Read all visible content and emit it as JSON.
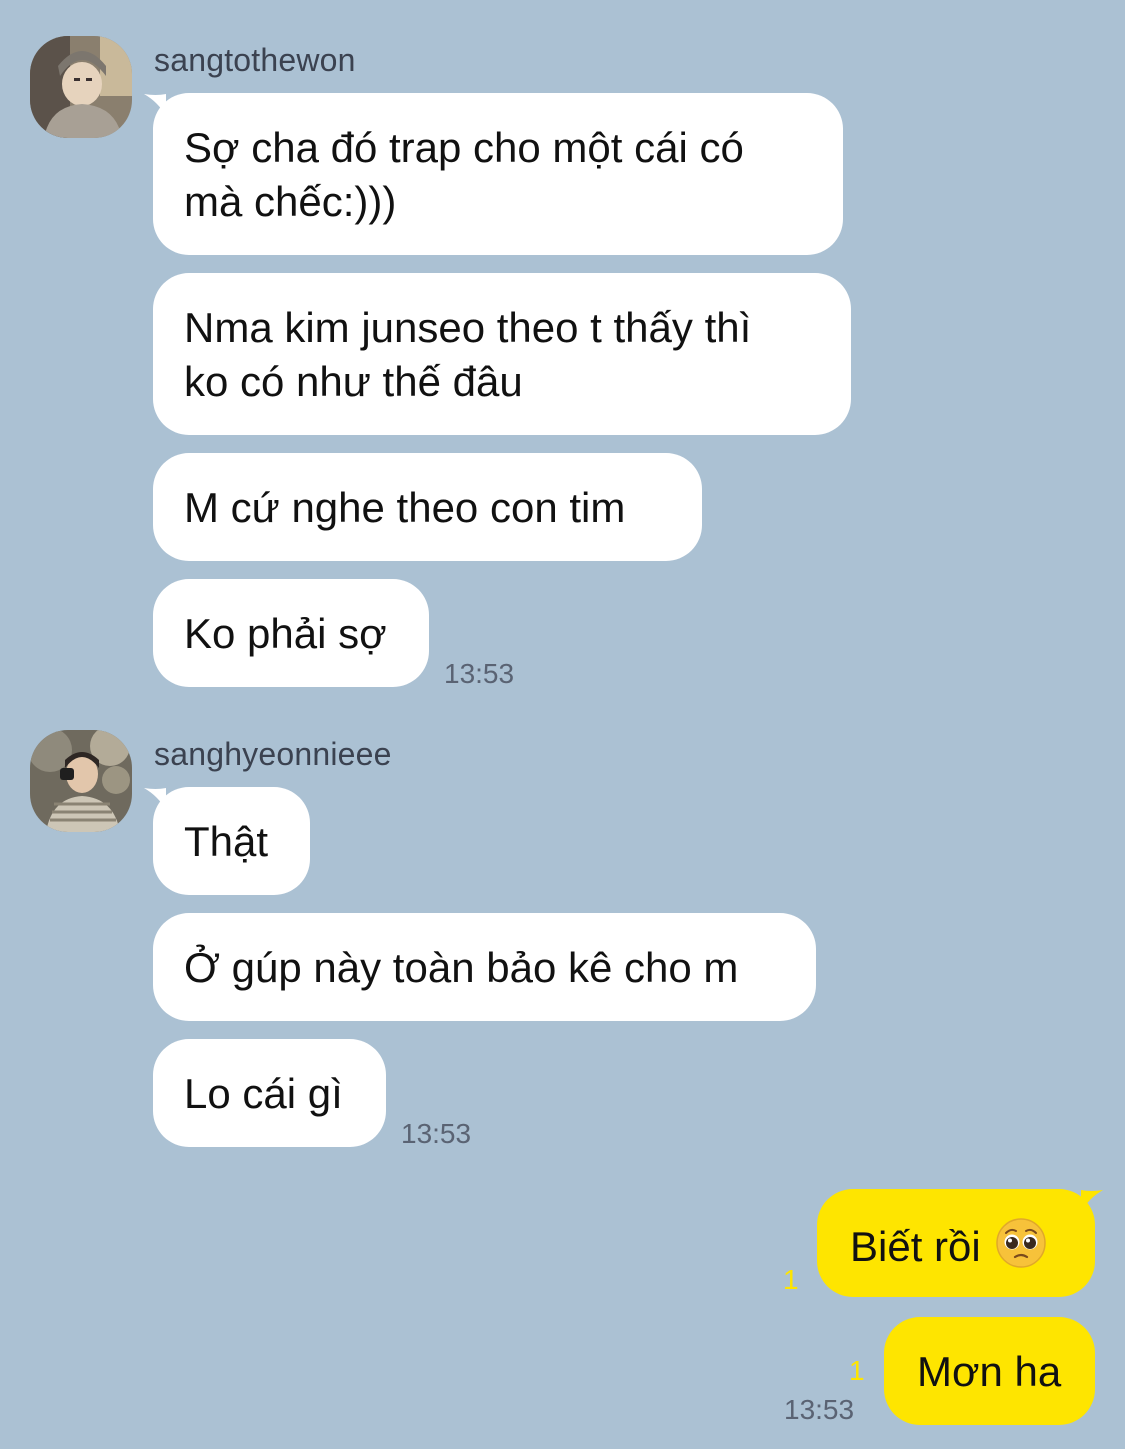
{
  "chat": {
    "groups": [
      {
        "sender": "sangtothewon",
        "messages": [
          {
            "line1": "Sợ cha đó trap cho một cái có",
            "line2": "mà chếc:)))"
          },
          {
            "line1": "Nma kim junseo theo t thấy thì",
            "line2": "ko có như thế đâu"
          },
          {
            "text": "M cứ nghe theo con tim"
          },
          {
            "text": "Ko phải sợ"
          }
        ],
        "time": "13:53"
      },
      {
        "sender": "sanghyeonnieee",
        "messages": [
          {
            "text": "Thật"
          },
          {
            "text": "Ở gúp này toàn bảo kê cho m"
          },
          {
            "text": "Lo cái gì"
          }
        ],
        "time": "13:53"
      }
    ],
    "outgoing": {
      "messages": [
        {
          "text": "Biết rồi",
          "emoji": "pleading-face-emoji",
          "unread": "1"
        },
        {
          "text": "Mơn ha",
          "unread": "1"
        }
      ],
      "time": "13:53"
    }
  },
  "colors": {
    "background": "#abc1d3",
    "incoming_bubble": "#ffffff",
    "outgoing_bubble": "#fee500",
    "unread_count": "#fee500",
    "timestamp": "#5a6373"
  }
}
